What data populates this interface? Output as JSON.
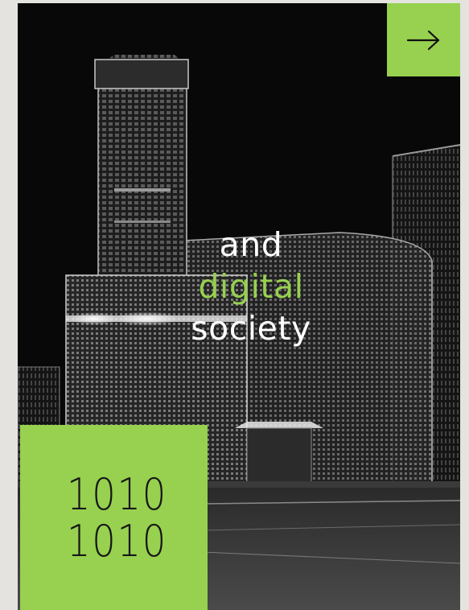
{
  "nav": {
    "next_icon": "arrow-right-icon",
    "accent": "#97d14f"
  },
  "headline": {
    "line1": "and",
    "line2": "digital",
    "line3": "society"
  },
  "binary": {
    "line1": "1010",
    "line2": "1010"
  },
  "colors": {
    "accent": "#97d14f",
    "background": "#090909",
    "text": "#ffffff"
  }
}
